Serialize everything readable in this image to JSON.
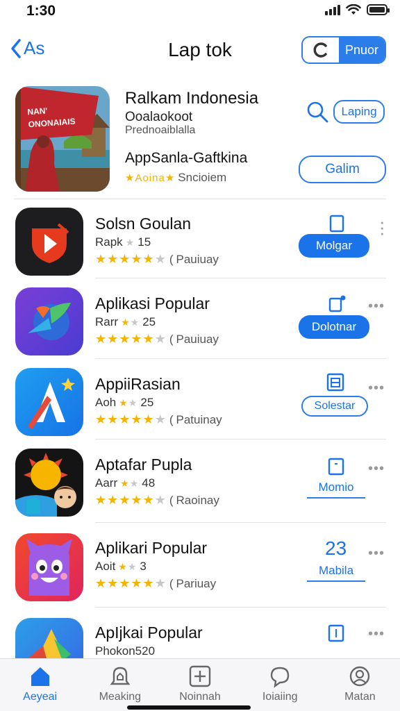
{
  "status": {
    "time": "1:30"
  },
  "nav": {
    "back_label": "As",
    "title": "Lap tok",
    "toggle_label": "Pnuor"
  },
  "featured": {
    "name": "Ralkam Indonesia",
    "subtitle": "Ooalaokoot",
    "subtitle2": "Prednoaiblalla",
    "banner_line1": "NAN'",
    "banner_line2": "ONONAIAIS",
    "name2": "AppSanla-Gaftkina",
    "rating_label": "Aoina",
    "rating_suffix": "Sncioiem",
    "search_label": "Laping",
    "button_label": "Galim"
  },
  "apps": [
    {
      "name": "Solsn Goulan",
      "sub": "Rapk",
      "sub_stars_value": "15",
      "rating_note": "Pauiuay",
      "action_label": "Molgar",
      "action_style": "filled"
    },
    {
      "name": "Aplikasi Popular",
      "sub": "Rarr",
      "sub_stars_value": "25",
      "rating_note": "Pauiuay",
      "action_label": "Dolotnar",
      "action_style": "filled"
    },
    {
      "name": "AppiiRasian",
      "sub": "Aoh",
      "sub_stars_value": "25",
      "rating_note": "Patuinay",
      "action_label": "Solestar",
      "action_style": "outline"
    },
    {
      "name": "Aptafar Pupla",
      "sub": "Aarr",
      "sub_stars_value": "48",
      "rating_note": "Raoinay",
      "action_label": "Momio",
      "action_style": "text"
    },
    {
      "name": "Aplikari Popular",
      "sub": "Aoit",
      "sub_stars_value": "3",
      "rating_note": "Pariuay",
      "action_label": "Mabila",
      "action_style": "text"
    },
    {
      "name": "ApIjkai Popular",
      "sub": "Phokon520",
      "sub_stars_value": "",
      "rating_note": "",
      "action_label": "",
      "action_style": "none"
    }
  ],
  "action_icon_3": "23",
  "tabs": [
    {
      "label": "Aeyeai",
      "icon": "home-icon",
      "active": true
    },
    {
      "label": "Meaking",
      "icon": "bell-icon",
      "active": false
    },
    {
      "label": "Noinnah",
      "icon": "plus-square-icon",
      "active": false
    },
    {
      "label": "Ioiaiing",
      "icon": "chat-icon",
      "active": false
    },
    {
      "label": "Matan",
      "icon": "profile-icon",
      "active": false
    }
  ],
  "colors": {
    "accent": "#1a73e8",
    "star": "#f5b400"
  }
}
